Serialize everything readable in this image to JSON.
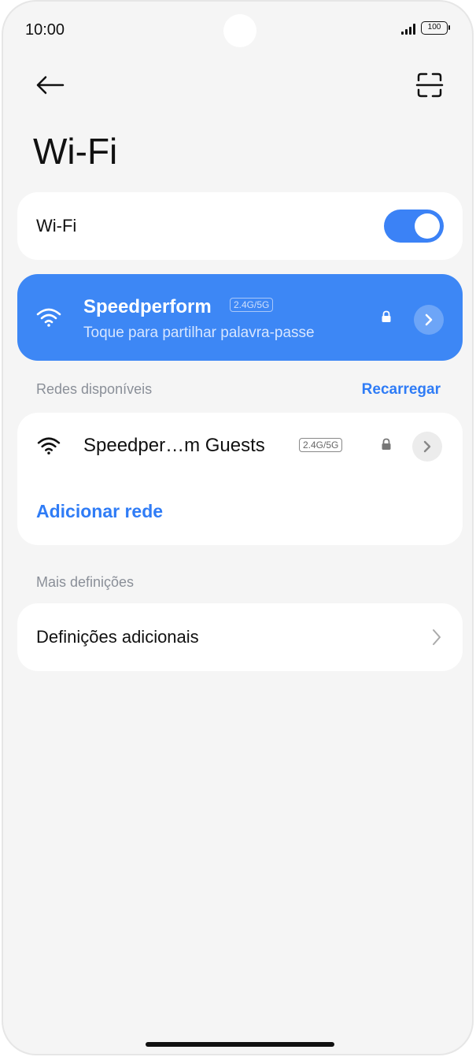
{
  "status_bar": {
    "time": "10:00",
    "battery": "100",
    "icons": [
      "signal-icon",
      "battery-icon"
    ]
  },
  "header": {
    "back_icon": "back-arrow-icon",
    "scan_icon": "qr-scan-icon",
    "title": "Wi-Fi"
  },
  "wifi_toggle": {
    "label": "Wi-Fi",
    "enabled": true
  },
  "connected_network": {
    "name": "Speedperform",
    "band": "2.4G/5G",
    "subtitle": "Toque para partilhar palavra-passe",
    "secured": true
  },
  "available": {
    "section_label": "Redes disponíveis",
    "reload_label": "Recarregar",
    "networks": [
      {
        "name": "Speedper…m Guests",
        "band": "2.4G/5G",
        "secured": true
      }
    ],
    "add_network_label": "Adicionar rede"
  },
  "more_settings": {
    "section_label": "Mais definições",
    "additional_label": "Definições adicionais"
  },
  "colors": {
    "accent": "#3d87f5",
    "link": "#2f7cf6",
    "background": "#f5f5f5"
  }
}
